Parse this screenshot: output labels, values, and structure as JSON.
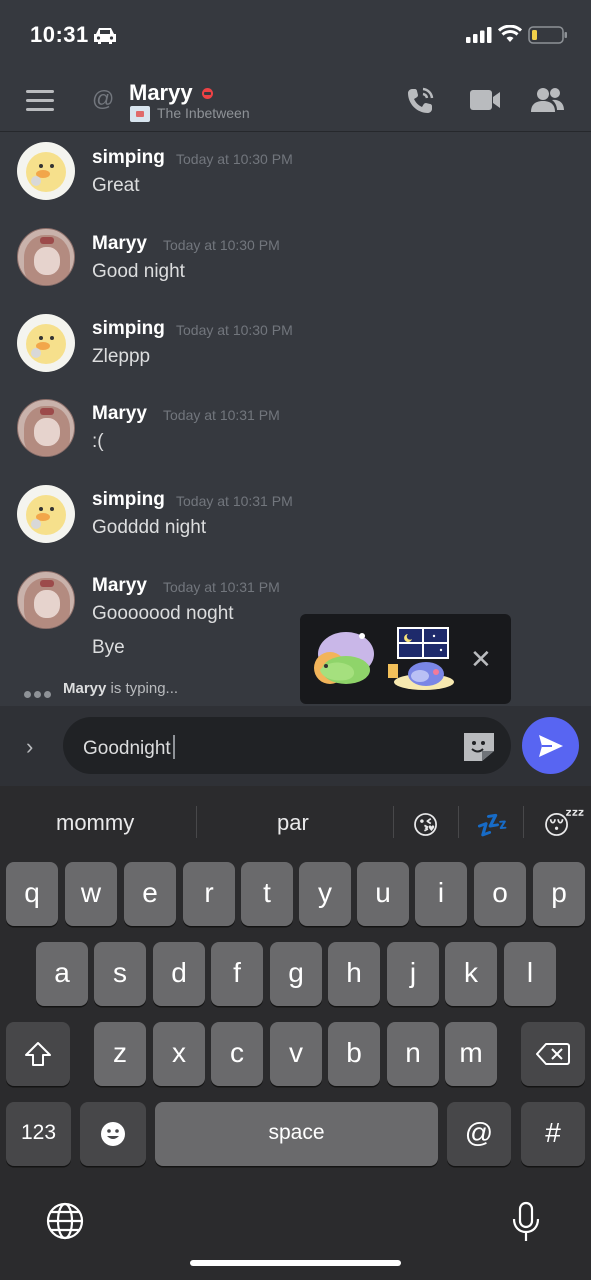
{
  "status_bar": {
    "time": "10:31"
  },
  "header": {
    "name": "Maryy",
    "server": "The Inbetween",
    "icons": [
      "hamburger-icon",
      "at-icon",
      "call-icon",
      "video-icon",
      "members-icon"
    ]
  },
  "messages": [
    {
      "author": "simping",
      "timestamp": "Today at 10:30 PM",
      "lines": [
        "Great"
      ],
      "avatar": "chick"
    },
    {
      "author": "Maryy",
      "timestamp": "Today at 10:30 PM",
      "lines": [
        "Good night"
      ],
      "avatar": "girl"
    },
    {
      "author": "simping",
      "timestamp": "Today at 10:30 PM",
      "lines": [
        "Zleppp"
      ],
      "avatar": "chick"
    },
    {
      "author": "Maryy",
      "timestamp": "Today at 10:31 PM",
      "lines": [
        ":("
      ],
      "avatar": "girl"
    },
    {
      "author": "simping",
      "timestamp": "Today at 10:31 PM",
      "lines": [
        "Godddd night"
      ],
      "avatar": "chick"
    },
    {
      "author": "Maryy",
      "timestamp": "Today at 10:31 PM",
      "lines": [
        "Gooooood noght",
        "Bye"
      ],
      "avatar": "girl"
    }
  ],
  "typing": {
    "name": "Maryy",
    "suffix": " is typing..."
  },
  "composer": {
    "value": "Goodnight"
  },
  "keyboard": {
    "suggestions": [
      "mommy",
      "par",
      "😘",
      "💤",
      "😴"
    ],
    "row1": [
      "q",
      "w",
      "e",
      "r",
      "t",
      "y",
      "u",
      "i",
      "o",
      "p"
    ],
    "row2": [
      "a",
      "s",
      "d",
      "f",
      "g",
      "h",
      "j",
      "k",
      "l"
    ],
    "row3": [
      "z",
      "x",
      "c",
      "v",
      "b",
      "n",
      "m"
    ],
    "bottom": {
      "numbers": "123",
      "space": "space",
      "at": "@",
      "hash": "#"
    }
  },
  "colors": {
    "accent": "#5865f2",
    "bg": "#36393f",
    "dnd": "#ed4245"
  }
}
